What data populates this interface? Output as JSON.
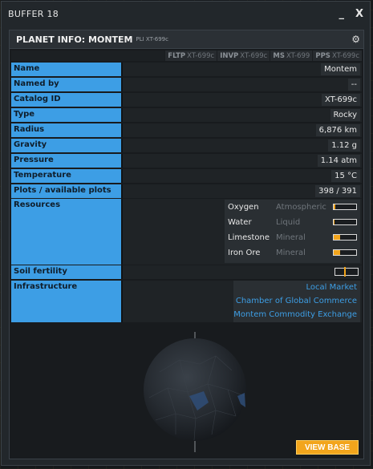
{
  "window": {
    "title": "BUFFER 18",
    "minimize": "_",
    "close": "X"
  },
  "panel": {
    "title": "PLANET INFO: MONTEM",
    "subtitle": "PLI XT-699c"
  },
  "ratings": [
    {
      "key": "FLTP",
      "value": "XT-699c"
    },
    {
      "key": "INVP",
      "value": "XT-699c"
    },
    {
      "key": "MS",
      "value": "XT-699"
    },
    {
      "key": "PPS",
      "value": "XT-699c"
    }
  ],
  "fields": [
    {
      "label": "Name",
      "value": "Montem"
    },
    {
      "label": "Named by",
      "value": "--"
    },
    {
      "label": "Catalog ID",
      "value": "XT-699c"
    },
    {
      "label": "Type",
      "value": "Rocky"
    },
    {
      "label": "Radius",
      "value": "6,876 km"
    },
    {
      "label": "Gravity",
      "value": "1.12 g"
    },
    {
      "label": "Pressure",
      "value": "1.14 atm"
    },
    {
      "label": "Temperature",
      "value": "15 °C"
    },
    {
      "label": "Plots / available plots",
      "value": "398 / 391"
    }
  ],
  "resources": {
    "label": "Resources",
    "items": [
      {
        "name": "Oxygen",
        "type": "Atmospheric",
        "level": 0.08
      },
      {
        "name": "Water",
        "type": "Liquid",
        "level": 0.05
      },
      {
        "name": "Limestone",
        "type": "Mineral",
        "level": 0.3
      },
      {
        "name": "Iron Ore",
        "type": "Mineral",
        "level": 0.3
      }
    ]
  },
  "soil": {
    "label": "Soil fertility",
    "level": 0.42
  },
  "infrastructure": {
    "label": "Infrastructure",
    "items": [
      "Local Market",
      "Chamber of Global Commerce",
      "Montem Commodity Exchange"
    ]
  },
  "view_base": "VIEW BASE",
  "colors": {
    "label_bg": "#3d9ee5",
    "accent": "#f2a51c",
    "link": "#3d9ee5"
  }
}
